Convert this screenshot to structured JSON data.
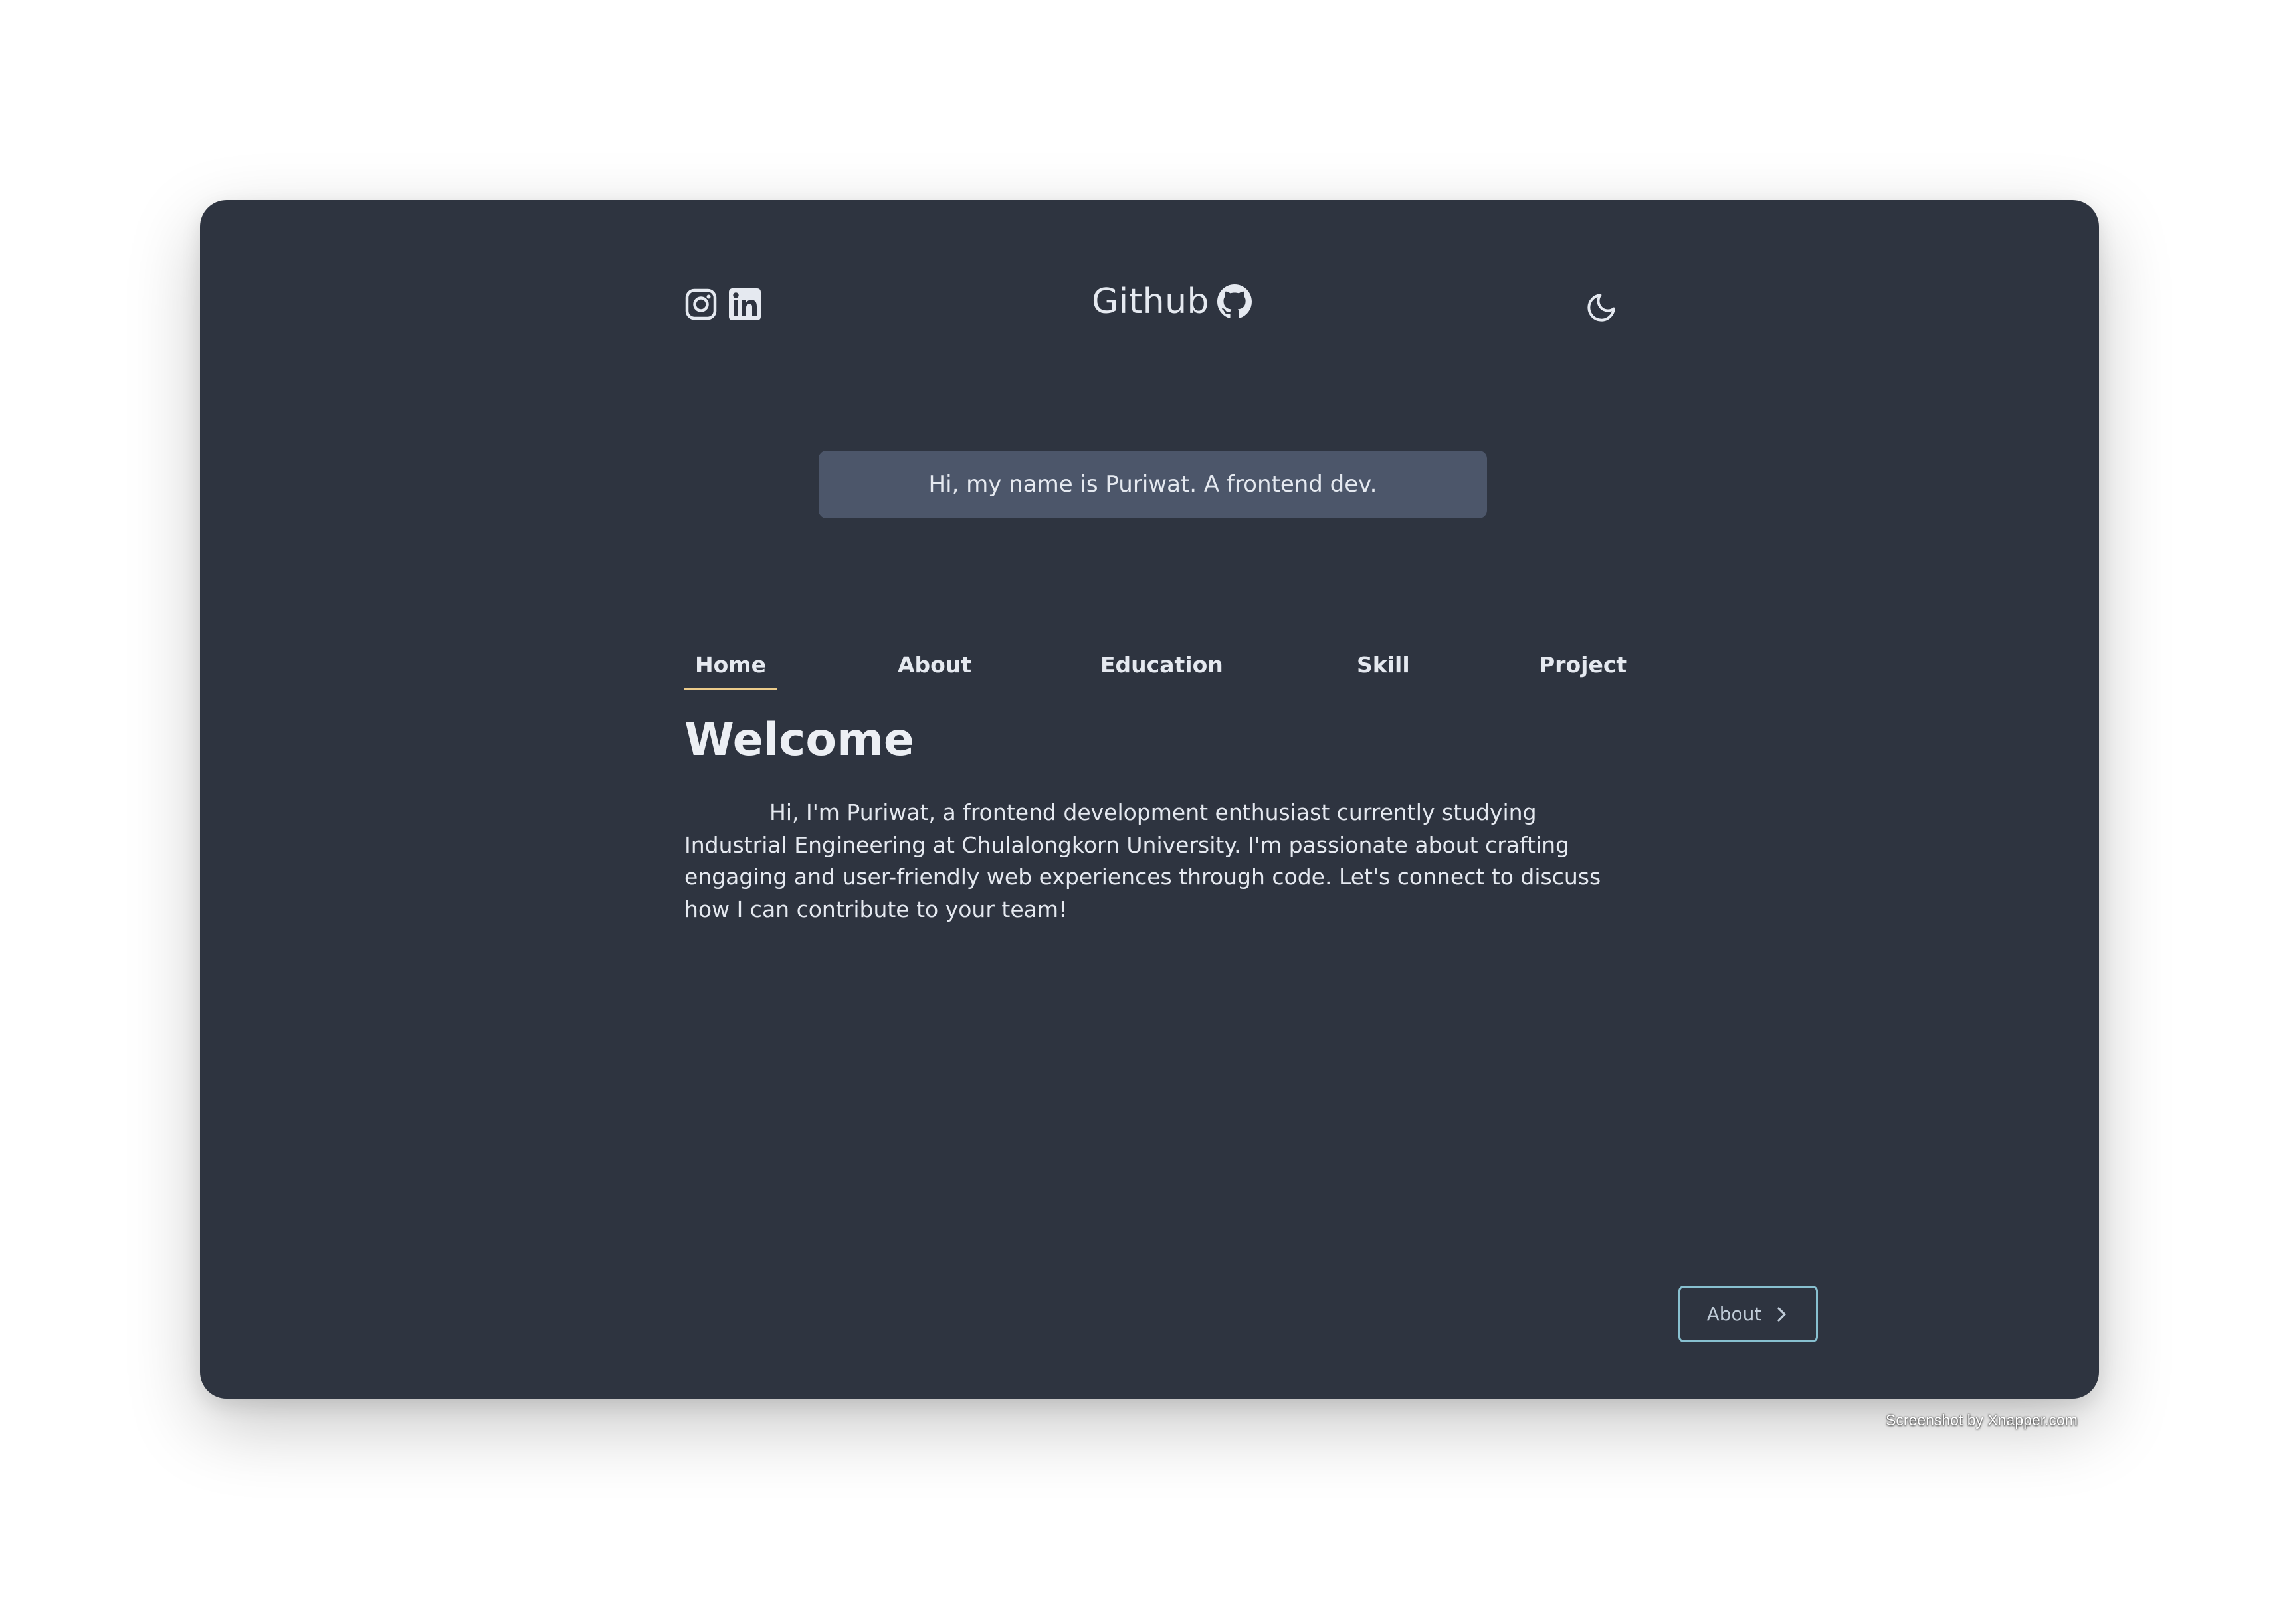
{
  "header": {
    "socials": [
      {
        "icon": "instagram-icon"
      },
      {
        "icon": "linkedin-icon"
      }
    ],
    "github_label": "Github",
    "github_icon": "github-icon",
    "theme_toggle_icon": "moon-icon"
  },
  "intro": {
    "text": "Hi, my name is Puriwat. A frontend dev."
  },
  "tabs": [
    {
      "label": "Home",
      "active": true
    },
    {
      "label": "About",
      "active": false
    },
    {
      "label": "Education",
      "active": false
    },
    {
      "label": "Skill",
      "active": false
    },
    {
      "label": "Project",
      "active": false
    }
  ],
  "welcome": {
    "title": "Welcome",
    "body": "Hi, I'm Puriwat, a frontend development enthusiast currently studying Industrial Engineering at Chulalongkorn University. I'm passionate about crafting engaging and user-friendly web experiences through code. Let's connect to discuss how I can contribute to your team!"
  },
  "next_button": {
    "label": "About",
    "icon": "chevron-right-icon"
  },
  "watermark": "Screenshot by Xnapper.com",
  "colors": {
    "background": "#2e3440",
    "banner": "#4c566a",
    "text": "#e5e9f0",
    "active_tab_underline": "#ebcb8b",
    "button_border": "#88c0d0"
  }
}
